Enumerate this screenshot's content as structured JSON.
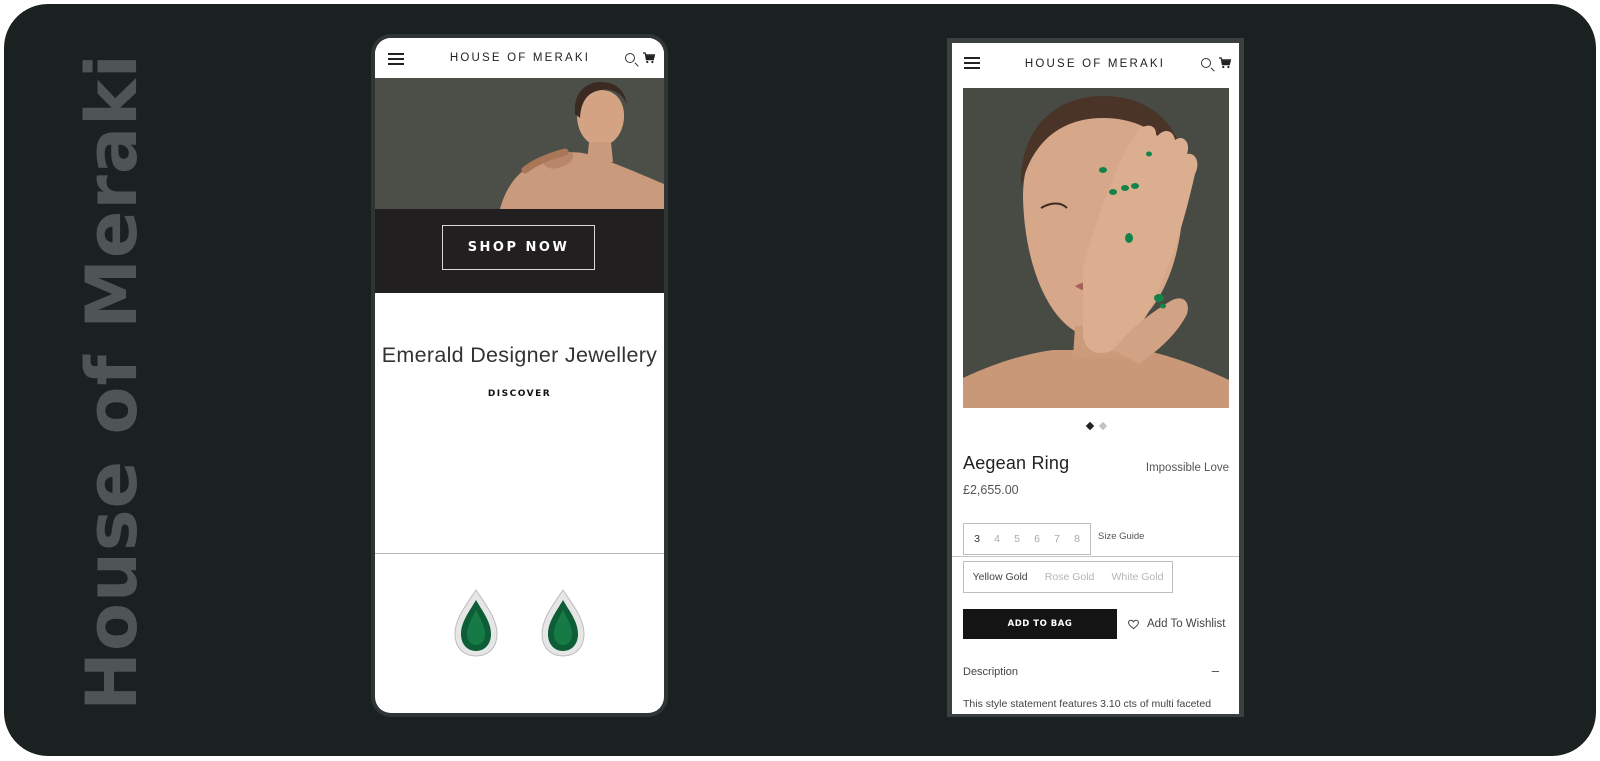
{
  "brand": {
    "vertical_title": "House of Meraki"
  },
  "phone_home": {
    "header": {
      "title": "HOUSE OF MERAKI",
      "menu_icon": "hamburger-menu-icon",
      "search_icon": "search-icon",
      "cart_icon": "cart-icon"
    },
    "hero": {
      "cta_label": "SHOP NOW"
    },
    "section": {
      "heading": "Emerald Designer Jewellery",
      "link_label": "DISCOVER"
    },
    "product_image": "emerald-pear-earrings"
  },
  "phone_product": {
    "header": {
      "title": "HOUSE OF MERAKI",
      "menu_icon": "hamburger-menu-icon",
      "search_icon": "search-icon",
      "cart_icon": "cart-icon"
    },
    "carousel": {
      "slides": 2,
      "active_index": 0
    },
    "product": {
      "name": "Aegean Ring",
      "collection": "Impossible Love",
      "price": "£2,655.00"
    },
    "sizes": {
      "options": [
        "3",
        "4",
        "5",
        "6",
        "7",
        "8"
      ],
      "selected": "3"
    },
    "size_guide_label": "Size Guide",
    "metals": {
      "options": [
        "Yellow Gold",
        "Rose Gold",
        "White Gold"
      ],
      "selected": "Yellow Gold"
    },
    "add_to_bag_label": "ADD TO BAG",
    "wishlist_label": "Add To Wishlist",
    "description": {
      "heading": "Description",
      "toggle": "–",
      "text": "This style statement features 3.10 cts of multi faceted"
    }
  }
}
